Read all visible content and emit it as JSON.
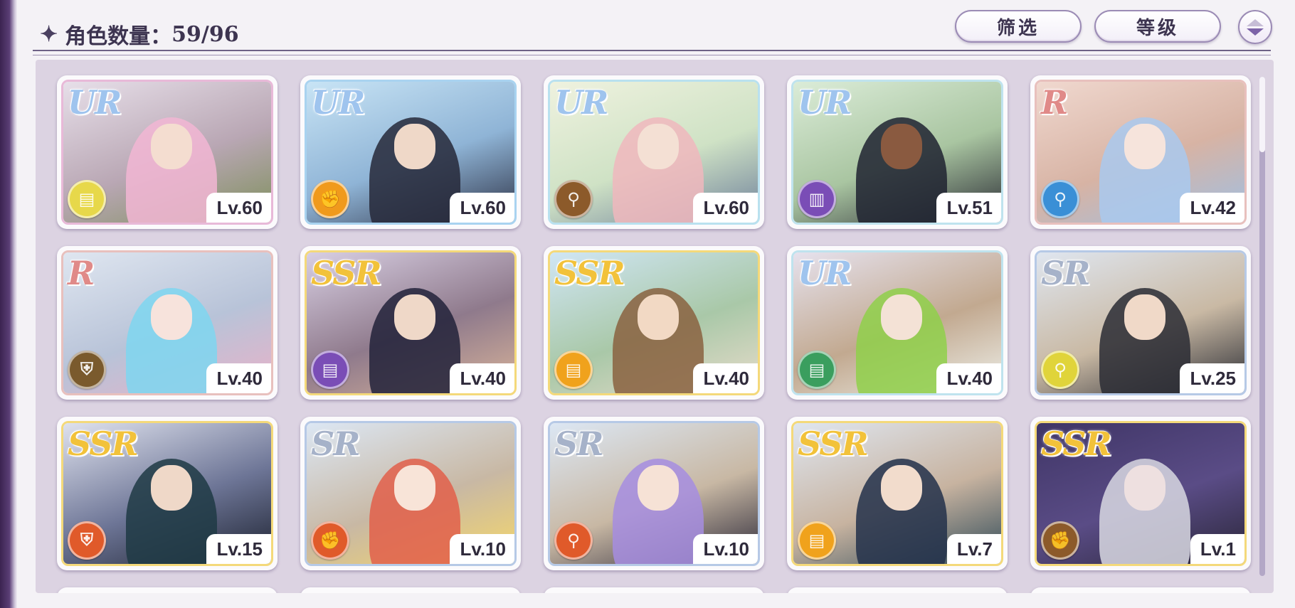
{
  "header": {
    "title_label": "角色数量：",
    "count": "59/96",
    "filter_label": "筛选",
    "level_label": "等级"
  },
  "cards": [
    {
      "rarity": "UR",
      "level": "Lv.60",
      "icon": "scroll-icon",
      "badge_color": "#e7d84a",
      "rarity_color": "#9fc4ee",
      "frame": "#e8b9d8",
      "sky": "#e7dfe9",
      "sky2": "#b9a7b4",
      "ground": "#7d8f5a",
      "hair": "#f2b6d3",
      "skin": "#f4ddd0"
    },
    {
      "rarity": "UR",
      "level": "Lv.60",
      "icon": "fist-icon",
      "badge_color": "#f09a1c",
      "rarity_color": "#9fc4ee",
      "frame": "#a9d3f0",
      "sky": "#c8e4f5",
      "sky2": "#8fb4d6",
      "ground": "#2e3347",
      "hair": "#262838",
      "skin": "#efd8c8"
    },
    {
      "rarity": "UR",
      "level": "Lv.60",
      "icon": "wand-icon",
      "badge_color": "#8c5a2a",
      "rarity_color": "#9fc4ee",
      "frame": "#b9e1ef",
      "sky": "#eff2df",
      "sky2": "#cfe2c5",
      "ground": "#6d7f9a",
      "hair": "#f0b7bd",
      "skin": "#f4e0d4"
    },
    {
      "rarity": "UR",
      "level": "Lv.51",
      "icon": "book-icon",
      "badge_color": "#7a4db6",
      "rarity_color": "#9fc4ee",
      "frame": "#bfe3ee",
      "sky": "#dbecd8",
      "sky2": "#a9c5a1",
      "ground": "#2b2d35",
      "hair": "#1f2230",
      "skin": "#8a5a40"
    },
    {
      "rarity": "R",
      "level": "Lv.42",
      "icon": "wand-icon",
      "badge_color": "#3a8fd6",
      "rarity_color": "#e08a88",
      "frame": "#e8c0bd",
      "sky": "#f0d8cf",
      "sky2": "#d7b3a4",
      "ground": "#9fc0e4",
      "hair": "#a9c9ef",
      "skin": "#f6e4dc"
    },
    {
      "rarity": "R",
      "level": "Lv.40",
      "icon": "shield-icon",
      "badge_color": "#7a5a2d",
      "rarity_color": "#e08a88",
      "frame": "#e8c0bd",
      "sky": "#dfe6f0",
      "sky2": "#b8c3d8",
      "ground": "#e9b2c8",
      "hair": "#7ed6f0",
      "skin": "#f7e3dc"
    },
    {
      "rarity": "SSR",
      "level": "Lv.40",
      "icon": "scroll-icon",
      "badge_color": "#7a4db6",
      "rarity_color": "#f2c23a",
      "frame": "#f4d97a",
      "sky": "#d8cfe3",
      "sky2": "#8f7a8c",
      "ground": "#d9b49a",
      "hair": "#22223a",
      "skin": "#efd8c8"
    },
    {
      "rarity": "SSR",
      "level": "Lv.40",
      "icon": "scroll-icon",
      "badge_color": "#f0a21c",
      "rarity_color": "#f2c23a",
      "frame": "#f4d97a",
      "sky": "#d0e6f5",
      "sky2": "#a9c8a8",
      "ground": "#e8dccb",
      "hair": "#8a6240",
      "skin": "#f2d9c4"
    },
    {
      "rarity": "UR",
      "level": "Lv.40",
      "icon": "scroll-icon",
      "badge_color": "#3a9e5e",
      "rarity_color": "#9fc4ee",
      "frame": "#bfe3ee",
      "sky": "#e6e2ee",
      "sky2": "#c2a990",
      "ground": "#eef0ea",
      "hair": "#8fd04a",
      "skin": "#f4e2d6"
    },
    {
      "rarity": "SR",
      "level": "Lv.25",
      "icon": "wand-icon",
      "badge_color": "#e0d43a",
      "rarity_color": "#a6b2c9",
      "frame": "#b6c9e6",
      "sky": "#dfe6f0",
      "sky2": "#c9b9a4",
      "ground": "#2a2c34",
      "hair": "#2a2c34",
      "skin": "#f0d9c8"
    },
    {
      "rarity": "SSR",
      "level": "Lv.15",
      "icon": "shield-icon",
      "badge_color": "#e05a2a",
      "rarity_color": "#f2c23a",
      "frame": "#f4d97a",
      "sky": "#dfe2ee",
      "sky2": "#6d7596",
      "ground": "#1d2230",
      "hair": "#1f3a44",
      "skin": "#efd8c8"
    },
    {
      "rarity": "SR",
      "level": "Lv.10",
      "icon": "fist-icon",
      "badge_color": "#e05a2a",
      "rarity_color": "#a6b2c9",
      "frame": "#b6c9e6",
      "sky": "#dce7f4",
      "sky2": "#c8b8a4",
      "ground": "#f6d86a",
      "hair": "#e25f4a",
      "skin": "#f8e4d8"
    },
    {
      "rarity": "SR",
      "level": "Lv.10",
      "icon": "wand-icon",
      "badge_color": "#e05a2a",
      "rarity_color": "#a6b2c9",
      "frame": "#b6c9e6",
      "sky": "#dce7f4",
      "sky2": "#c8b8a4",
      "ground": "#2b2838",
      "hair": "#a68de0",
      "skin": "#f6e2d6"
    },
    {
      "rarity": "SSR",
      "level": "Lv.7",
      "icon": "scroll-icon",
      "badge_color": "#f0a21c",
      "rarity_color": "#f2c23a",
      "frame": "#f4d97a",
      "sky": "#dfe6f0",
      "sky2": "#c7b3a0",
      "ground": "#2f4a58",
      "hair": "#22304a",
      "skin": "#f2dccc"
    },
    {
      "rarity": "SSR",
      "level": "Lv.1",
      "icon": "fist-icon",
      "badge_color": "#8c5a2a",
      "rarity_color": "#f2c23a",
      "frame": "#f4d97a",
      "sky": "#3f3566",
      "sky2": "#5a4c86",
      "ground": "#2a2638",
      "hair": "#d8d8e2",
      "skin": "#eee0e0"
    }
  ],
  "colors": {
    "accent": "#7c62a8",
    "text": "#3d3450",
    "panel": "#dcd3e2"
  }
}
